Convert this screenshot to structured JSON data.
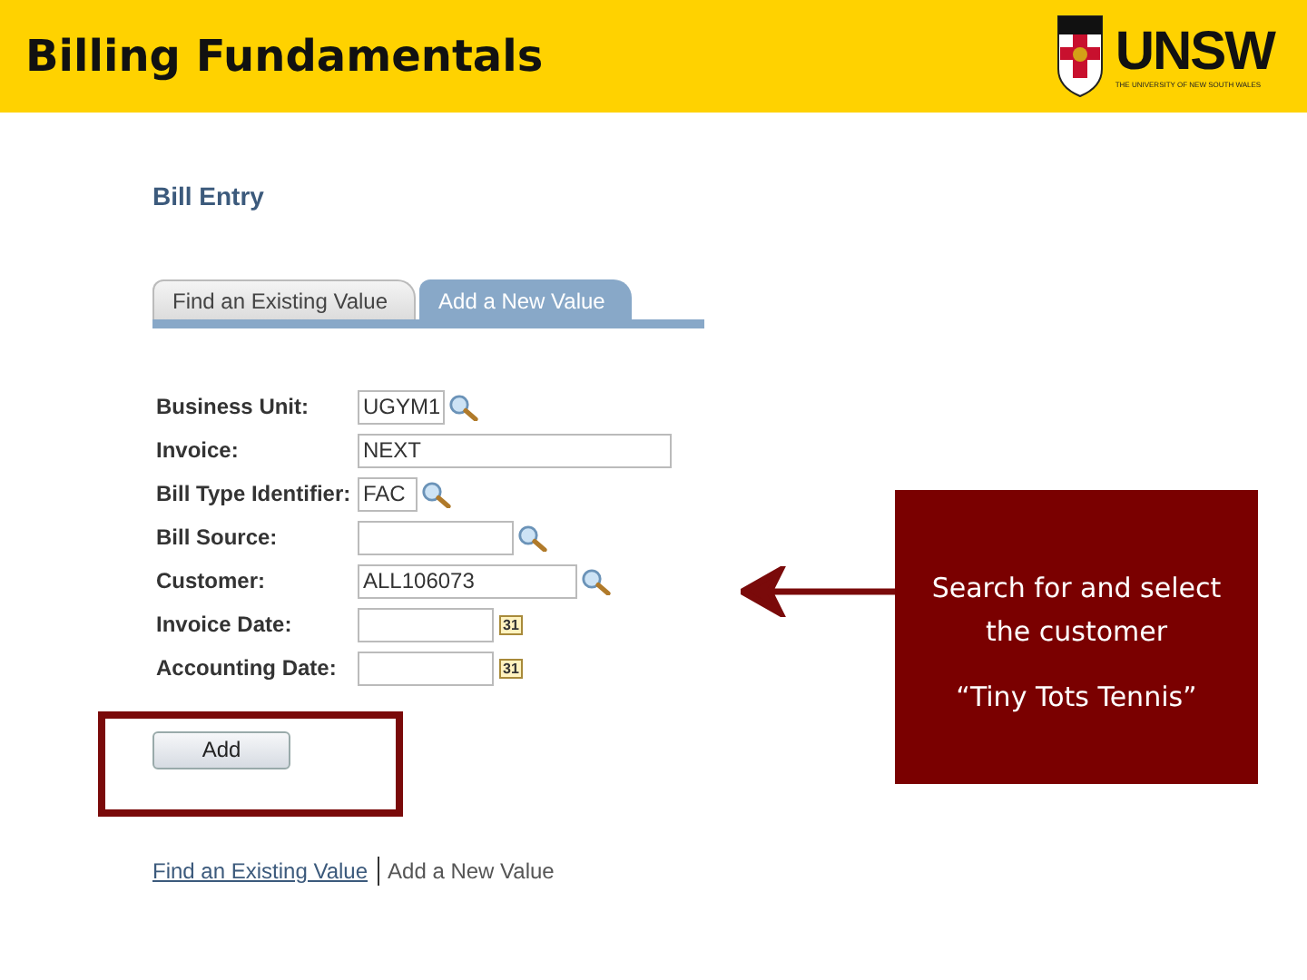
{
  "header": {
    "title": "Billing Fundamentals",
    "logo": {
      "wordmark": "UNSW",
      "tagline": "THE UNIVERSITY OF NEW SOUTH WALES"
    }
  },
  "page_title": "Bill Entry",
  "tabs": [
    {
      "label": "Find an Existing Value",
      "selected": false
    },
    {
      "label": "Add a New Value",
      "selected": true
    }
  ],
  "fields": [
    {
      "label": "Business Unit:",
      "value": "UGYM1",
      "kind": "short-lookup"
    },
    {
      "label": "Invoice:",
      "value": "NEXT",
      "kind": "text"
    },
    {
      "label": "Bill Type Identifier:",
      "value": "FAC",
      "kind": "tiny-lookup"
    },
    {
      "label": "Bill Source:",
      "kind": "medium-lookup"
    },
    {
      "label": "Customer:",
      "value": "ALL106073",
      "kind": "long-lookup"
    },
    {
      "label": "Invoice Date:",
      "kind": "date",
      "icon_text": "31"
    },
    {
      "label": "Accounting Date:",
      "kind": "date",
      "icon_text": "31"
    }
  ],
  "add_button": "Add",
  "footer_links": [
    {
      "label": "Find an Existing Value",
      "selected": false
    },
    {
      "label": "Add a New Value",
      "selected": true
    }
  ],
  "callout": {
    "lines": [
      "Search for and select",
      "the customer",
      "“Tiny Tots Tennis”"
    ]
  }
}
